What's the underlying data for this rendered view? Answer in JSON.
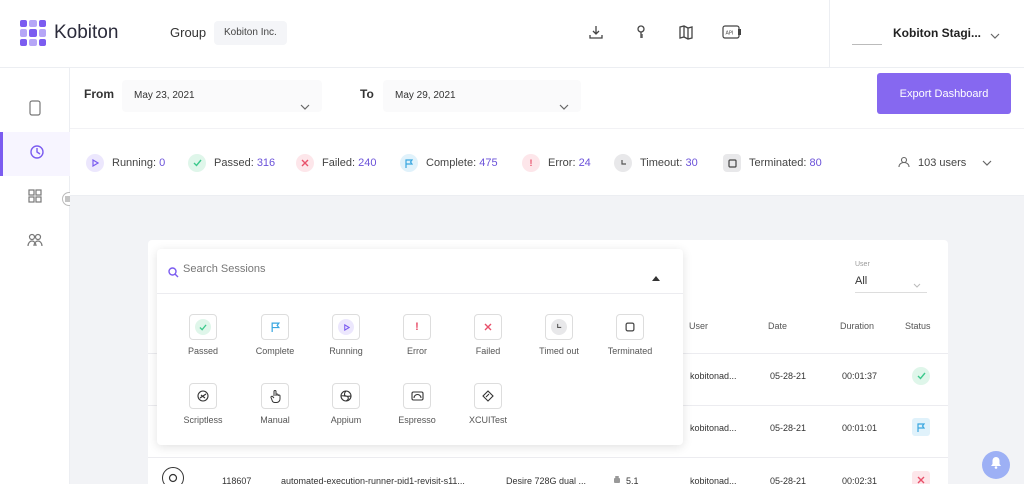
{
  "app": {
    "name": "Kobiton"
  },
  "header": {
    "group_label": "Group",
    "group_value": "Kobiton Inc.",
    "account_name": "Kobiton Stagi...",
    "icons": [
      "download-icon",
      "key-icon",
      "map-icon",
      "api-icon"
    ],
    "icon_api_text": "API"
  },
  "filters": {
    "from_label": "From",
    "from_value": "May 23, 2021",
    "to_label": "To",
    "to_value": "May 29, 2021",
    "export_label": "Export Dashboard"
  },
  "stats": [
    {
      "label": "Running:",
      "value": "0",
      "color": "#7b5cf0"
    },
    {
      "label": "Passed:",
      "value": "316",
      "color": "#3cc98c"
    },
    {
      "label": "Failed:",
      "value": "240",
      "color": "#e8506a"
    },
    {
      "label": "Complete:",
      "value": "475",
      "color": "#3aa7e0"
    },
    {
      "label": "Error:",
      "value": "24",
      "color": "#e8506a"
    },
    {
      "label": "Timeout:",
      "value": "30",
      "color": "#666666"
    },
    {
      "label": "Terminated:",
      "value": "80",
      "color": "#444444"
    }
  ],
  "users_filter": "103 users",
  "search": {
    "placeholder": "Search Sessions",
    "status_options": [
      "Passed",
      "Complete",
      "Running",
      "Error",
      "Failed",
      "Timed out",
      "Terminated"
    ],
    "type_options": [
      "Scriptless",
      "Manual",
      "Appium",
      "Espresso",
      "XCUITest"
    ]
  },
  "table": {
    "user_filter_label": "User",
    "user_filter_value": "All",
    "columns": [
      "User",
      "Date",
      "Duration",
      "Status"
    ],
    "rows": [
      {
        "user": "kobitonad...",
        "date": "05-28-21",
        "duration": "00:01:37",
        "status": "passed"
      },
      {
        "user": "kobitonad...",
        "date": "05-28-21",
        "duration": "00:01:01",
        "status": "complete"
      },
      {
        "id": "118607",
        "name": "automated-execution-runner-pid1-revisit-s11...",
        "device": "Desire 728G dual ...",
        "os": "5.1",
        "user": "kobitonad...",
        "date": "05-28-21",
        "duration": "00:02:31",
        "status": "failed"
      }
    ]
  }
}
